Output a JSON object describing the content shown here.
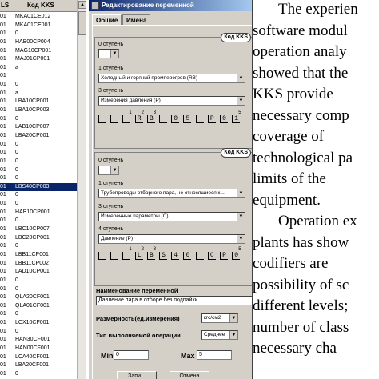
{
  "kks_table": {
    "headers": [
      "LS",
      "Код KKS"
    ],
    "scroll_arrow": "▲",
    "rows": [
      {
        "c1": "01",
        "c2": "MKA01CE012"
      },
      {
        "c1": "01",
        "c2": "MKA01CE001"
      },
      {
        "c1": "01",
        "c2": "0"
      },
      {
        "c1": "01",
        "c2": "HAB00CP004"
      },
      {
        "c1": "01",
        "c2": "MAG10CP001"
      },
      {
        "c1": "01",
        "c2": "MAJ01CP001"
      },
      {
        "c1": "01",
        "c2": "a"
      },
      {
        "c1": "01",
        "c2": ""
      },
      {
        "c1": "01",
        "c2": "0"
      },
      {
        "c1": "01",
        "c2": "a"
      },
      {
        "c1": "01",
        "c2": "LBA10CP001"
      },
      {
        "c1": "01",
        "c2": "LBA10CP003"
      },
      {
        "c1": "01",
        "c2": "0"
      },
      {
        "c1": "01",
        "c2": "LAB10CP007"
      },
      {
        "c1": "01",
        "c2": "LBA20CP001"
      },
      {
        "c1": "01",
        "c2": "0"
      },
      {
        "c1": "01",
        "c2": "0"
      },
      {
        "c1": "01",
        "c2": "0"
      },
      {
        "c1": "01",
        "c2": "0"
      },
      {
        "c1": "01",
        "c2": "0"
      },
      {
        "c1": "01",
        "c2": "LBS40CP003",
        "selected": true
      },
      {
        "c1": "01",
        "c2": "0"
      },
      {
        "c1": "01",
        "c2": "0"
      },
      {
        "c1": "01",
        "c2": "HAB10CP001"
      },
      {
        "c1": "01",
        "c2": "0"
      },
      {
        "c1": "01",
        "c2": "LBC10CP007"
      },
      {
        "c1": "01",
        "c2": "LBC20CP001"
      },
      {
        "c1": "01",
        "c2": "0"
      },
      {
        "c1": "01",
        "c2": "LBB11CP001"
      },
      {
        "c1": "01",
        "c2": "LBB11CP002"
      },
      {
        "c1": "01",
        "c2": "LAD10CP001"
      },
      {
        "c1": "01",
        "c2": "0"
      },
      {
        "c1": "01",
        "c2": "0"
      },
      {
        "c1": "01",
        "c2": "QLA20CF001"
      },
      {
        "c1": "01",
        "c2": "QLA01CF001"
      },
      {
        "c1": "01",
        "c2": "0"
      },
      {
        "c1": "01",
        "c2": "LCX10CF001"
      },
      {
        "c1": "01",
        "c2": "0"
      },
      {
        "c1": "01",
        "c2": "HAN30CF001"
      },
      {
        "c1": "01",
        "c2": "HAN00CF001"
      },
      {
        "c1": "01",
        "c2": "LCA40CF001"
      },
      {
        "c1": "01",
        "c2": "LBA20CF001"
      },
      {
        "c1": "01",
        "c2": "0"
      },
      {
        "c1": "01",
        "c2": ""
      }
    ]
  },
  "editor": {
    "title": "Редактирование переменной",
    "tabs": [
      "Общие",
      "Имена"
    ],
    "group1": {
      "title": "Код KKS",
      "step0_label": "0 ступень",
      "step1_label": "1 ступень",
      "step1_value": "Холодный и горячий промперегрев (RB)",
      "step3_label": "3 ступень",
      "step3_value": "Измерения давления (P)",
      "code_digits": [
        "",
        "",
        "1",
        "2",
        "3",
        "",
        "",
        "",
        "",
        "",
        "",
        "5"
      ],
      "code_chars": [
        "",
        "",
        "",
        "R",
        "B",
        "",
        "0",
        "5",
        "",
        "P",
        "0",
        "1"
      ]
    },
    "group2": {
      "title": "Код KKS",
      "step0_label": "0 ступень",
      "step1_label": "1 ступень",
      "step1_value": "Трубопроводы отборного пара, не относящиеся к ...",
      "step3_label": "3 ступень",
      "step3_value": "Измеренные параметры (C)",
      "step4_label": "4 ступень",
      "step4_value": "Давление (P)",
      "code_digits": [
        "",
        "",
        "1",
        "2",
        "3",
        "",
        "",
        "",
        "",
        "",
        "",
        "5"
      ],
      "code_chars": [
        "",
        "",
        "",
        "L",
        "B",
        "S",
        "4",
        "0",
        "",
        "C",
        "P",
        "0"
      ]
    },
    "var_name_label": "Наименование переменной",
    "var_name_value": "Давление пара в отборе без подпайки",
    "dimension_label": "Размерность(ед.измерения)",
    "dimension_value": "кгс/см2",
    "operation_label": "Тип выполняемой операции",
    "operation_value": "Среднее",
    "min_label": "Min",
    "min_value": "0",
    "max_label": "Max",
    "max_value": "5",
    "save_label": "Запи...",
    "cancel_label": "Отмена"
  },
  "paper": {
    "lines": [
      "The experien",
      "software modul",
      "operation analy",
      "showed that the",
      "KKS provide",
      "necessary comp",
      "coverage    of",
      "technological pa",
      "limits of the",
      "equipment.",
      "Operation ex",
      "plants has show",
      "codifiers are",
      "possibility of sc",
      "different levels;",
      "number of class",
      "necessary cha"
    ]
  }
}
